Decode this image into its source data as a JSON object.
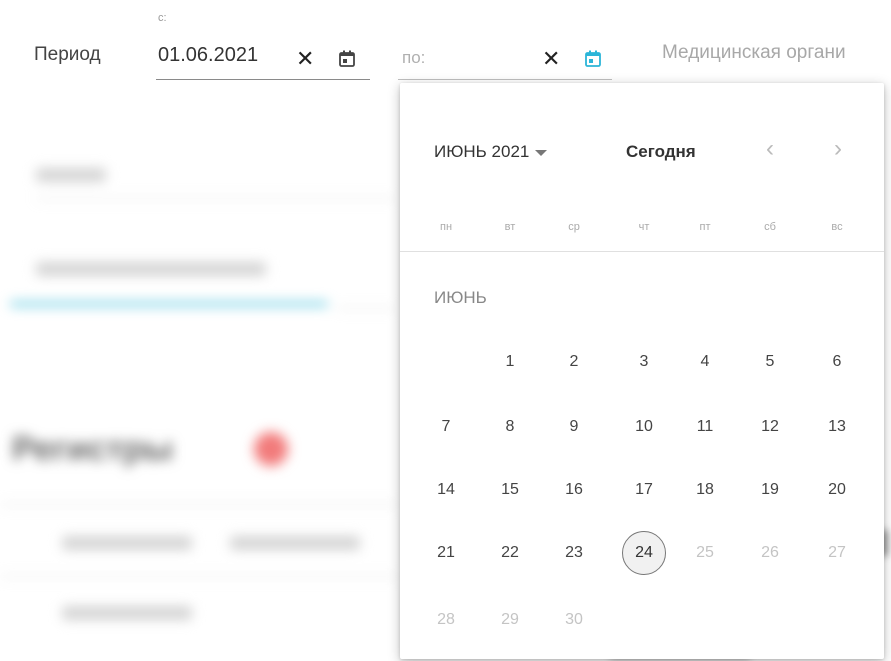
{
  "filters": {
    "period_label": "Период",
    "from_caption": "с:",
    "from_value": "01.06.2021",
    "to_placeholder": "по:",
    "org_placeholder": "Медицинская органи"
  },
  "background": {
    "heading": "Регистры"
  },
  "calendar": {
    "month_year": "ИЮНЬ 2021",
    "today_label": "Сегодня",
    "prev_label": "‹",
    "next_label": "›",
    "weekdays": [
      "пн",
      "вт",
      "ср",
      "чт",
      "пт",
      "сб",
      "вс"
    ],
    "month_caption": "ИЮНЬ",
    "days": [
      {
        "label": "1"
      },
      {
        "label": "2"
      },
      {
        "label": "3"
      },
      {
        "label": "4"
      },
      {
        "label": "5"
      },
      {
        "label": "6"
      },
      {
        "label": "7"
      },
      {
        "label": "8"
      },
      {
        "label": "9"
      },
      {
        "label": "10"
      },
      {
        "label": "11"
      },
      {
        "label": "12"
      },
      {
        "label": "13"
      },
      {
        "label": "14"
      },
      {
        "label": "15"
      },
      {
        "label": "16"
      },
      {
        "label": "17"
      },
      {
        "label": "18"
      },
      {
        "label": "19"
      },
      {
        "label": "20"
      },
      {
        "label": "21"
      },
      {
        "label": "22"
      },
      {
        "label": "23"
      },
      {
        "label": "24",
        "today": true
      },
      {
        "label": "25",
        "muted": true
      },
      {
        "label": "26",
        "muted": true
      },
      {
        "label": "27",
        "muted": true
      },
      {
        "label": "28",
        "muted": true
      },
      {
        "label": "29",
        "muted": true
      },
      {
        "label": "30",
        "muted": true
      }
    ]
  },
  "colors": {
    "accent": "#2bb5d8",
    "blurred_badge": "#f27b7b"
  }
}
